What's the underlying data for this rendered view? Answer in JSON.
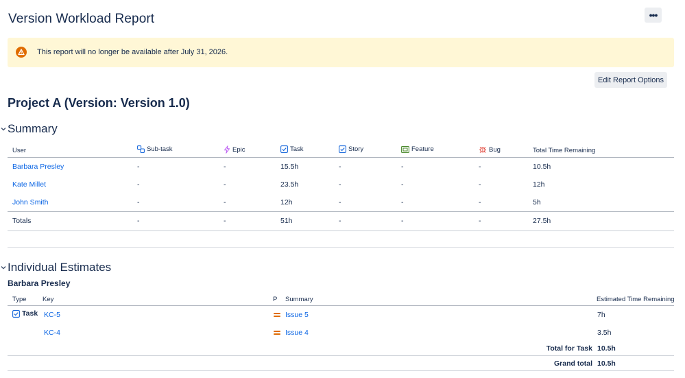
{
  "page": {
    "title": "Version Workload Report",
    "more_label": "•••"
  },
  "banner": {
    "message": "This report will no longer be available after July 31, 2026."
  },
  "edit_button": "Edit Report Options",
  "project_title": "Project A (Version: Version 1.0)",
  "summary": {
    "heading": "Summary",
    "columns": [
      "User",
      "Sub-task",
      "Epic",
      "Task",
      "Story",
      "Feature",
      "Bug",
      "Total Time Remaining"
    ],
    "rows": [
      [
        "Barbara Presley",
        "-",
        "-",
        "15.5h",
        "-",
        "-",
        "-",
        "10.5h"
      ],
      [
        "Kate Millet",
        "-",
        "-",
        "23.5h",
        "-",
        "-",
        "-",
        "12h"
      ],
      [
        "John Smith",
        "-",
        "-",
        "12h",
        "-",
        "-",
        "-",
        "5h"
      ]
    ],
    "totals": [
      "Totals",
      "-",
      "-",
      "51h",
      "-",
      "-",
      "-",
      "27.5h"
    ]
  },
  "individual": {
    "heading": "Individual Estimates",
    "user": "Barbara Presley",
    "columns": [
      "Type",
      "Key",
      "P",
      "Summary",
      "Estimated Time Remaining"
    ],
    "type_label": "Task",
    "rows": [
      {
        "key": "KC-5",
        "summary": "Issue 5",
        "estimate": "7h"
      },
      {
        "key": "KC-4",
        "summary": "Issue 4",
        "estimate": "3.5h"
      }
    ],
    "total_label": "Total for Task",
    "total_value": "10.5h",
    "grand_label": "Grand total",
    "grand_value": "10.5h"
  },
  "colors": {
    "link": "#0c66e4",
    "banner_bg": "#fff7d6",
    "warning": "#e06c00",
    "text": "#172b4d"
  },
  "icons": [
    "warning-icon",
    "subtask-icon",
    "epic-icon",
    "task-icon",
    "story-icon",
    "feature-icon",
    "bug-icon",
    "priority-medium-icon",
    "chevron-down-icon",
    "more-icon"
  ]
}
